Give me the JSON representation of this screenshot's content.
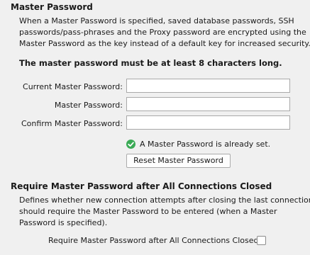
{
  "master_password": {
    "title": "Master Password",
    "description_lines": [
      "When a Master Password is specified, saved database passwords, SSH",
      "passwords/pass-phrases and the Proxy password are encrypted using the",
      "Master Password as the key instead of a default key for increased security."
    ],
    "notice": "The master password must be at least 8 characters long.",
    "fields": {
      "current": {
        "label": "Current Master Password:",
        "value": ""
      },
      "master": {
        "label": "Master Password:",
        "value": ""
      },
      "confirm": {
        "label": "Confirm Master Password:",
        "value": ""
      }
    },
    "status_text": "A Master Password is already set.",
    "status_icon": "check-circle-icon",
    "status_color": "#3aaa55",
    "reset_button_label": "Reset Master Password"
  },
  "require_section": {
    "title": "Require Master Password after All Connections Closed",
    "description_lines": [
      "Defines whether new connection attempts after closing the last connection",
      "should require the Master Password to be entered (when a Master",
      "Password is specified)."
    ],
    "checkbox_label": "Require Master Password after All Connections Closed:",
    "checkbox_checked": false
  }
}
